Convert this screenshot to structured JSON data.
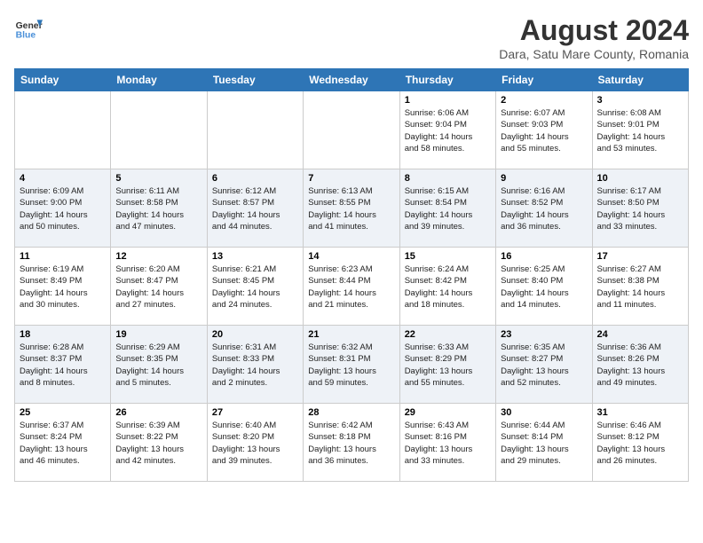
{
  "logo": {
    "line1": "General",
    "line2": "Blue"
  },
  "title": "August 2024",
  "location": "Dara, Satu Mare County, Romania",
  "days_of_week": [
    "Sunday",
    "Monday",
    "Tuesday",
    "Wednesday",
    "Thursday",
    "Friday",
    "Saturday"
  ],
  "weeks": [
    [
      {
        "day": "",
        "info": ""
      },
      {
        "day": "",
        "info": ""
      },
      {
        "day": "",
        "info": ""
      },
      {
        "day": "",
        "info": ""
      },
      {
        "day": "1",
        "info": "Sunrise: 6:06 AM\nSunset: 9:04 PM\nDaylight: 14 hours\nand 58 minutes."
      },
      {
        "day": "2",
        "info": "Sunrise: 6:07 AM\nSunset: 9:03 PM\nDaylight: 14 hours\nand 55 minutes."
      },
      {
        "day": "3",
        "info": "Sunrise: 6:08 AM\nSunset: 9:01 PM\nDaylight: 14 hours\nand 53 minutes."
      }
    ],
    [
      {
        "day": "4",
        "info": "Sunrise: 6:09 AM\nSunset: 9:00 PM\nDaylight: 14 hours\nand 50 minutes."
      },
      {
        "day": "5",
        "info": "Sunrise: 6:11 AM\nSunset: 8:58 PM\nDaylight: 14 hours\nand 47 minutes."
      },
      {
        "day": "6",
        "info": "Sunrise: 6:12 AM\nSunset: 8:57 PM\nDaylight: 14 hours\nand 44 minutes."
      },
      {
        "day": "7",
        "info": "Sunrise: 6:13 AM\nSunset: 8:55 PM\nDaylight: 14 hours\nand 41 minutes."
      },
      {
        "day": "8",
        "info": "Sunrise: 6:15 AM\nSunset: 8:54 PM\nDaylight: 14 hours\nand 39 minutes."
      },
      {
        "day": "9",
        "info": "Sunrise: 6:16 AM\nSunset: 8:52 PM\nDaylight: 14 hours\nand 36 minutes."
      },
      {
        "day": "10",
        "info": "Sunrise: 6:17 AM\nSunset: 8:50 PM\nDaylight: 14 hours\nand 33 minutes."
      }
    ],
    [
      {
        "day": "11",
        "info": "Sunrise: 6:19 AM\nSunset: 8:49 PM\nDaylight: 14 hours\nand 30 minutes."
      },
      {
        "day": "12",
        "info": "Sunrise: 6:20 AM\nSunset: 8:47 PM\nDaylight: 14 hours\nand 27 minutes."
      },
      {
        "day": "13",
        "info": "Sunrise: 6:21 AM\nSunset: 8:45 PM\nDaylight: 14 hours\nand 24 minutes."
      },
      {
        "day": "14",
        "info": "Sunrise: 6:23 AM\nSunset: 8:44 PM\nDaylight: 14 hours\nand 21 minutes."
      },
      {
        "day": "15",
        "info": "Sunrise: 6:24 AM\nSunset: 8:42 PM\nDaylight: 14 hours\nand 18 minutes."
      },
      {
        "day": "16",
        "info": "Sunrise: 6:25 AM\nSunset: 8:40 PM\nDaylight: 14 hours\nand 14 minutes."
      },
      {
        "day": "17",
        "info": "Sunrise: 6:27 AM\nSunset: 8:38 PM\nDaylight: 14 hours\nand 11 minutes."
      }
    ],
    [
      {
        "day": "18",
        "info": "Sunrise: 6:28 AM\nSunset: 8:37 PM\nDaylight: 14 hours\nand 8 minutes."
      },
      {
        "day": "19",
        "info": "Sunrise: 6:29 AM\nSunset: 8:35 PM\nDaylight: 14 hours\nand 5 minutes."
      },
      {
        "day": "20",
        "info": "Sunrise: 6:31 AM\nSunset: 8:33 PM\nDaylight: 14 hours\nand 2 minutes."
      },
      {
        "day": "21",
        "info": "Sunrise: 6:32 AM\nSunset: 8:31 PM\nDaylight: 13 hours\nand 59 minutes."
      },
      {
        "day": "22",
        "info": "Sunrise: 6:33 AM\nSunset: 8:29 PM\nDaylight: 13 hours\nand 55 minutes."
      },
      {
        "day": "23",
        "info": "Sunrise: 6:35 AM\nSunset: 8:27 PM\nDaylight: 13 hours\nand 52 minutes."
      },
      {
        "day": "24",
        "info": "Sunrise: 6:36 AM\nSunset: 8:26 PM\nDaylight: 13 hours\nand 49 minutes."
      }
    ],
    [
      {
        "day": "25",
        "info": "Sunrise: 6:37 AM\nSunset: 8:24 PM\nDaylight: 13 hours\nand 46 minutes."
      },
      {
        "day": "26",
        "info": "Sunrise: 6:39 AM\nSunset: 8:22 PM\nDaylight: 13 hours\nand 42 minutes."
      },
      {
        "day": "27",
        "info": "Sunrise: 6:40 AM\nSunset: 8:20 PM\nDaylight: 13 hours\nand 39 minutes."
      },
      {
        "day": "28",
        "info": "Sunrise: 6:42 AM\nSunset: 8:18 PM\nDaylight: 13 hours\nand 36 minutes."
      },
      {
        "day": "29",
        "info": "Sunrise: 6:43 AM\nSunset: 8:16 PM\nDaylight: 13 hours\nand 33 minutes."
      },
      {
        "day": "30",
        "info": "Sunrise: 6:44 AM\nSunset: 8:14 PM\nDaylight: 13 hours\nand 29 minutes."
      },
      {
        "day": "31",
        "info": "Sunrise: 6:46 AM\nSunset: 8:12 PM\nDaylight: 13 hours\nand 26 minutes."
      }
    ]
  ]
}
